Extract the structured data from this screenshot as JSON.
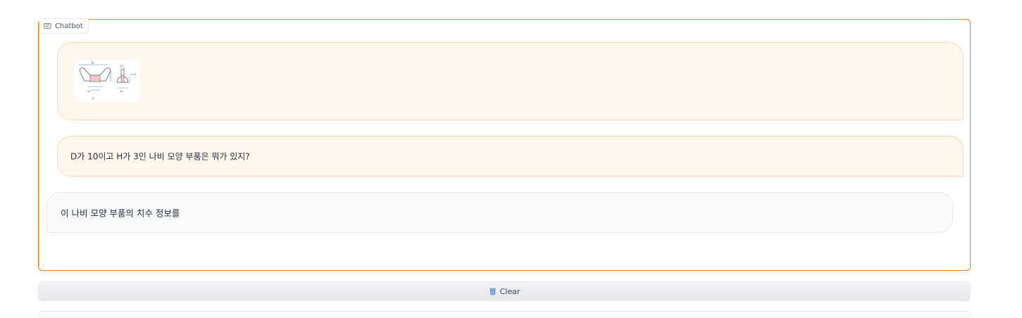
{
  "chatbot": {
    "label": "Chatbot",
    "messages": [
      {
        "role": "user",
        "type": "image",
        "image_icon": "wing-nut-drawing"
      },
      {
        "role": "user",
        "type": "text",
        "text": "D가 10이고 H가 3인 나비 모양 부품은 뭐가 있지?"
      },
      {
        "role": "bot",
        "type": "text",
        "text": "이 나비 모양 부품의 치수 정보를"
      }
    ]
  },
  "clear_button": {
    "label": "Clear",
    "icon": "trash-icon"
  },
  "colors": {
    "accent": "#f97316",
    "user_bubble": "#fff6ec",
    "bot_bubble": "#f9fafb"
  }
}
